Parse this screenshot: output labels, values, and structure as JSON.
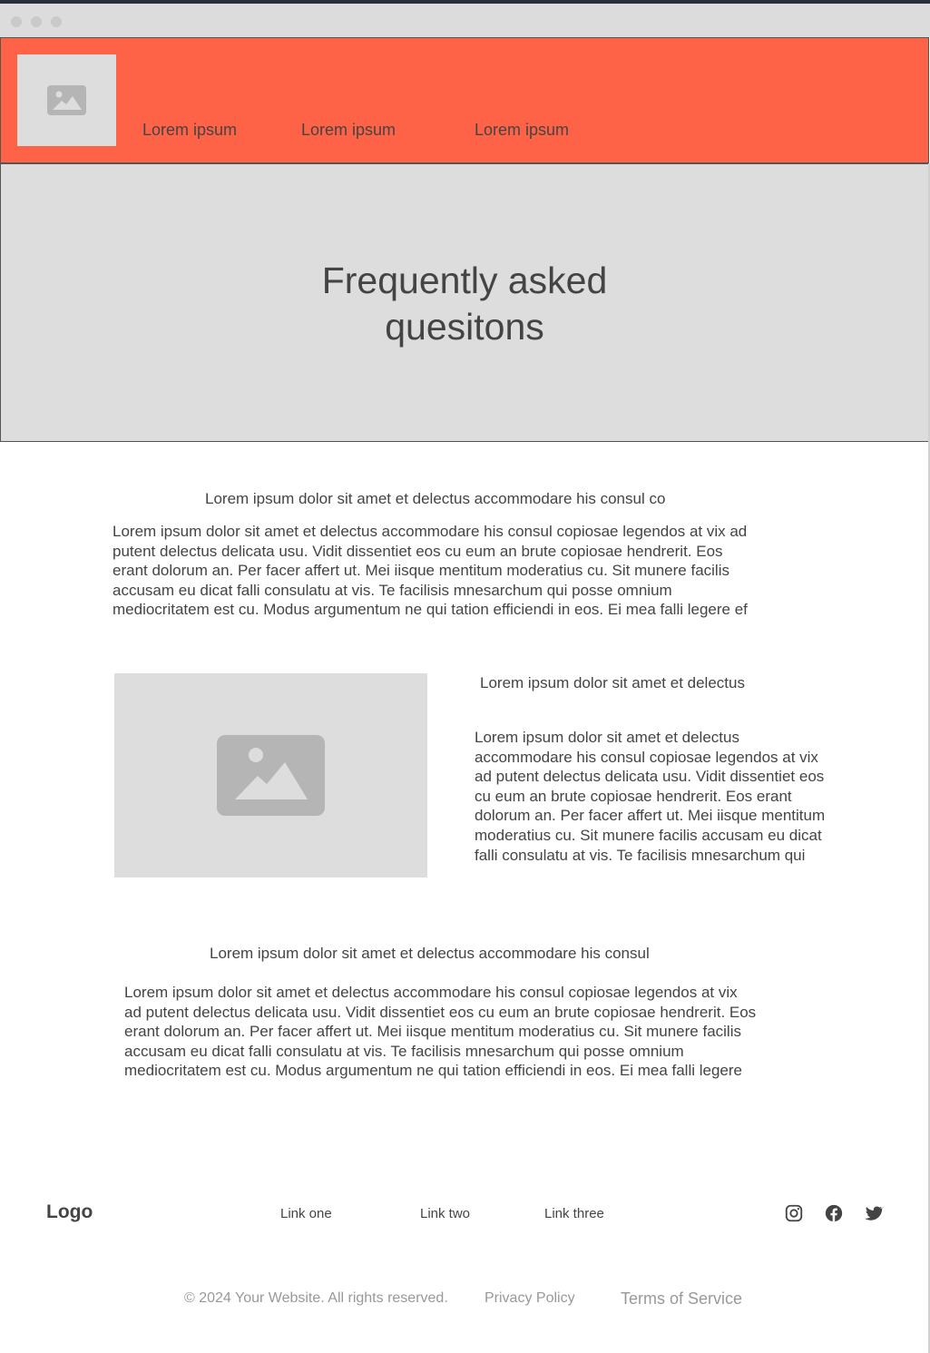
{
  "header": {
    "nav": [
      "Lorem ipsum",
      "Lorem ipsum",
      "Lorem ipsum"
    ]
  },
  "hero": {
    "title_line1": "Frequently asked",
    "title_line2": "quesitons"
  },
  "section1": {
    "subtitle": "Lorem ipsum dolor sit amet et delectus accommodare his consul co",
    "lines": [
      "Lorem ipsum dolor sit amet et delectus accommodare his consul copiosae legendos at vix ad",
      "putent delectus delicata usu. Vidit dissentiet eos cu eum an brute copiosae hendrerit. Eos",
      "erant dolorum an. Per facer affert ut. Mei iisque mentitum moderatius cu. Sit munere facilis",
      "accusam eu dicat falli consulatu at vis. Te facilisis mnesarchum qui posse omnium",
      "mediocritatem est cu. Modus argumentum ne qui tation efficiendi in eos. Ei mea falli legere ef"
    ]
  },
  "section2": {
    "subtitle": "Lorem ipsum dolor sit amet et delectus",
    "lines": [
      "Lorem ipsum dolor sit amet et delectus",
      "accommodare his consul copiosae legendos at vix",
      "ad putent delectus delicata usu. Vidit dissentiet eos",
      "cu eum an brute copiosae hendrerit. Eos erant",
      "dolorum an. Per facer affert ut. Mei iisque mentitum",
      "moderatius cu. Sit munere facilis accusam eu dicat",
      "falli consulatu at vis. Te facilisis mnesarchum qui"
    ]
  },
  "section3": {
    "subtitle": "Lorem ipsum dolor sit amet et delectus accommodare his consul",
    "lines": [
      "Lorem ipsum dolor sit amet et delectus accommodare his consul copiosae legendos at vix",
      "ad putent delectus delicata usu. Vidit dissentiet eos cu eum an brute copiosae hendrerit. Eos",
      "erant dolorum an. Per facer affert ut. Mei iisque mentitum moderatius cu. Sit munere facilis",
      "accusam eu dicat falli consulatu at vis. Te facilisis mnesarchum qui posse omnium",
      "mediocritatem est cu. Modus argumentum ne qui tation efficiendi in eos. Ei mea falli legere"
    ]
  },
  "footer": {
    "logo": "Logo",
    "links": [
      "Link one",
      "Link two",
      "Link three"
    ],
    "social_icons": [
      "instagram-icon",
      "facebook-icon",
      "twitter-icon"
    ],
    "copyright": "© 2024 Your Website. All rights reserved.",
    "privacy": "Privacy Policy",
    "terms": "Terms of Service"
  },
  "colors": {
    "header_bg": "#ff6347",
    "placeholder_bg": "#dddddd",
    "text": "#444444"
  }
}
